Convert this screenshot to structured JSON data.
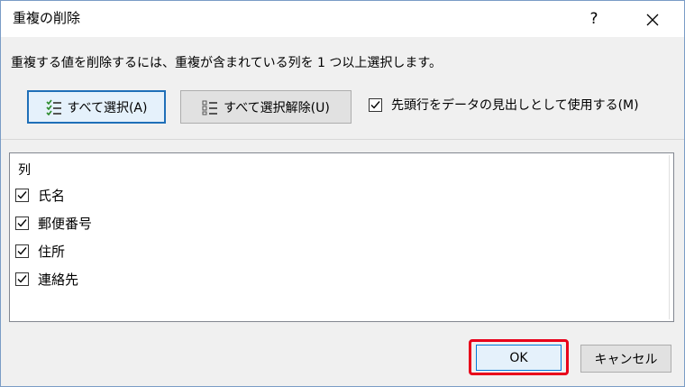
{
  "dialog": {
    "title": "重複の削除",
    "help_label": "?",
    "close_label": "✕"
  },
  "instruction": "重複する値を削除するには、重複が含まれている列を 1 つ以上選択します。",
  "buttons": {
    "select_all": "すべて選択(A)",
    "deselect_all": "すべて選択解除(U)",
    "ok": "OK",
    "cancel": "キャンセル"
  },
  "header_option": {
    "label": "先頭行をデータの見出しとして使用する(M)",
    "checked": true
  },
  "columns": {
    "header": "列",
    "items": [
      {
        "label": "氏名",
        "checked": true
      },
      {
        "label": "郵便番号",
        "checked": true
      },
      {
        "label": "住所",
        "checked": true
      },
      {
        "label": "連絡先",
        "checked": true
      }
    ]
  },
  "colors": {
    "highlight": "#e8001a",
    "accent": "#0078d7"
  }
}
